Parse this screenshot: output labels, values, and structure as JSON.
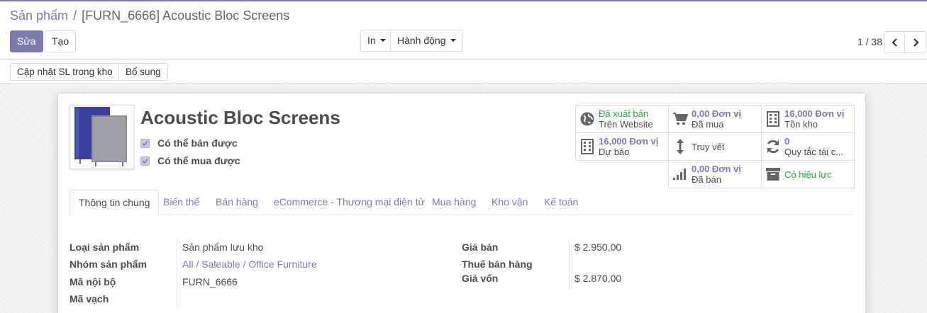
{
  "breadcrumb": {
    "parent": "Sản phẩm",
    "separator": "/",
    "current": "[FURN_6666] Acoustic Bloc Screens"
  },
  "toolbar": {
    "edit_label": "Sửa",
    "create_label": "Tạo",
    "print_label": "In",
    "action_label": "Hành động"
  },
  "pager": {
    "value": "1 / 38"
  },
  "statusbar": {
    "update_qty_label": "Cập nhật SL trong kho",
    "replenish_label": "Bổ sung"
  },
  "product": {
    "name": "Acoustic Bloc Screens",
    "can_be_sold": "Có thể bán được",
    "can_be_purchased": "Có thể mua được"
  },
  "smart_buttons": {
    "website": {
      "value": "Đã xuất bản",
      "label": "Trên Website",
      "icon": "globe-icon"
    },
    "purchased": {
      "value": "0,00 Đơn vị",
      "label": "Đã mua",
      "icon": "cart-icon"
    },
    "on_hand": {
      "value": "16,000 Đơn vị",
      "label": "Tồn kho",
      "icon": "building-icon"
    },
    "forecast": {
      "value": "16,000 Đơn vị",
      "label": "Dự báo",
      "icon": "building-icon"
    },
    "traceability": {
      "label": "Truy vết",
      "icon": "arrows-vertical-icon"
    },
    "reordering": {
      "value": "0",
      "label": "Quy tắc tái c...",
      "icon": "refresh-icon"
    },
    "sold": {
      "value": "0,00 Đơn vị",
      "label": "Đã bán",
      "icon": "signal-icon"
    },
    "active": {
      "label": "Có hiệu lực",
      "icon": "archive-icon"
    }
  },
  "tabs": [
    "Thông tin chung",
    "Biến thể",
    "Bán hàng",
    "eCommerce - Thương mại điện tử",
    "Mua hàng",
    "Kho vận",
    "Kế toán"
  ],
  "general": {
    "type_label": "Loại sản phẩm",
    "type_value": "Sản phẩm lưu kho",
    "category_label": "Nhóm sản phẩm",
    "category_value": "All / Saleable / Office Furniture",
    "ref_label": "Mã nội bộ",
    "ref_value": "FURN_6666",
    "barcode_label": "Mã vạch",
    "price_label": "Giá bán",
    "price_value": "$ 2.950,00",
    "tax_label": "Thuế bán hàng",
    "cost_label": "Giá vốn",
    "cost_value": "$ 2.870,00"
  },
  "colors": {
    "brand": "#7c7bad",
    "success": "#28a745",
    "text": "#4c4c4c"
  }
}
